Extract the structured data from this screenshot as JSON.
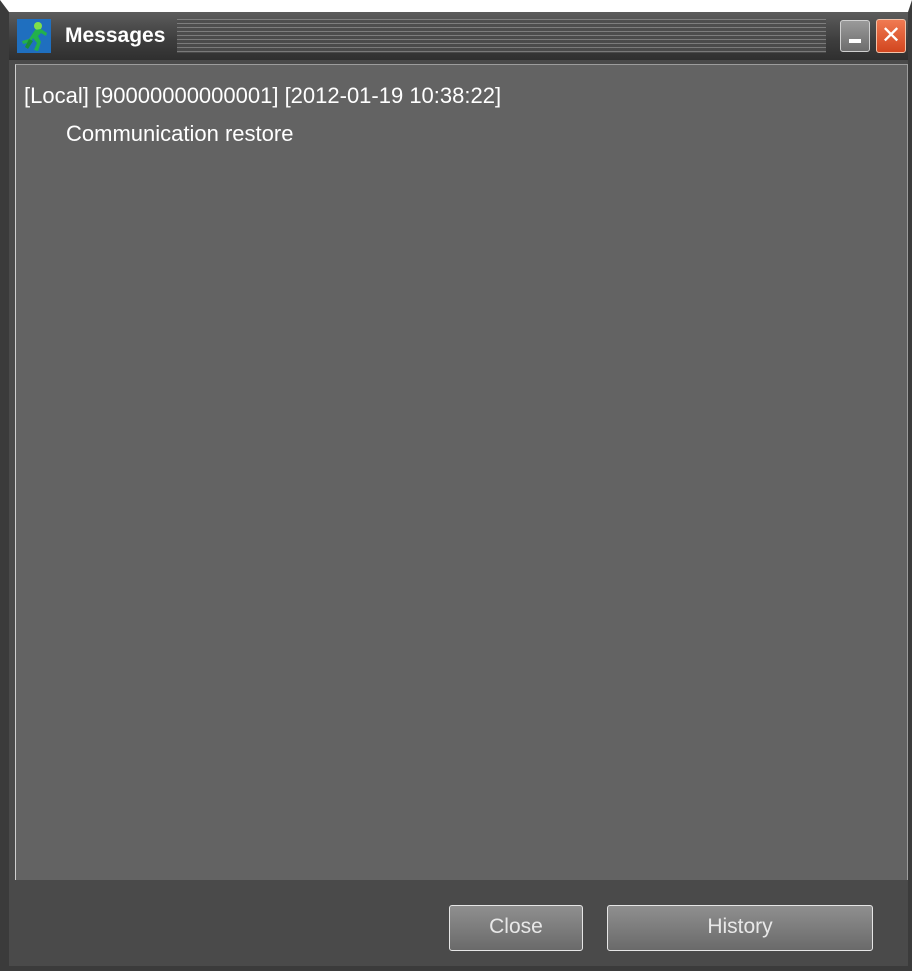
{
  "window": {
    "title": "Messages",
    "minimize_glyph": "",
    "close_glyph": "✕"
  },
  "messages": [
    {
      "header": "[Local] [90000000000001] [2012-01-19 10:38:22]",
      "text": "Communication restore"
    }
  ],
  "buttons": {
    "close_label": "Close",
    "history_label": "History"
  },
  "colors": {
    "background": "#636363",
    "close_accent": "#e05a2b",
    "icon_green": "#22b14c"
  },
  "icons": {
    "app_icon": "running-figure-icon",
    "minimize": "minimize-icon",
    "close": "close-icon"
  }
}
